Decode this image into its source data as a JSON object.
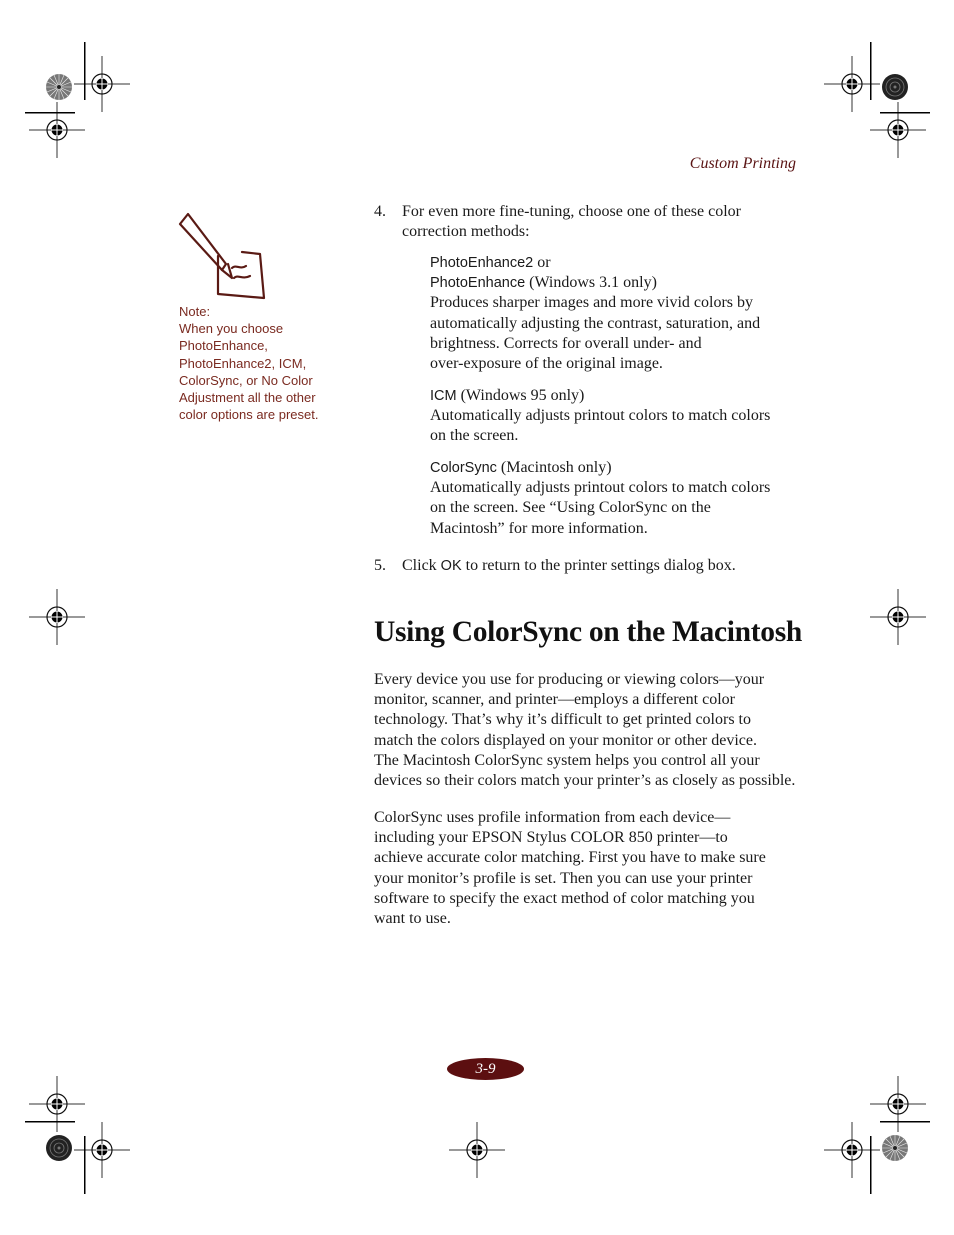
{
  "running_head": "Custom Printing",
  "note": {
    "icon": "pencil-note-icon",
    "label": "Note:",
    "lines": [
      "When you choose",
      "PhotoEnhance,",
      "PhotoEnhance2, ICM,",
      "ColorSync, or No Color",
      "Adjustment all the other",
      "color options are preset."
    ]
  },
  "steps": [
    {
      "number": "4.",
      "text_lines": [
        "For even more fine-tuning, choose one of these color",
        "correction methods:"
      ]
    },
    {
      "number": "5.",
      "text_before": "Click ",
      "ui_term": "OK",
      "text_after": " to return to the printer settings dialog box."
    }
  ],
  "methods": [
    {
      "name_line1": "PhotoEnhance2",
      "name_line1_suffix": " or",
      "name_line2": "PhotoEnhance",
      "qualifier": " (Windows 3.1 only)",
      "description_lines": [
        "Produces sharper images and more vivid colors by",
        "automatically adjusting the contrast, saturation, and",
        "brightness. Corrects for overall under- and",
        "over-exposure of the original image."
      ]
    },
    {
      "name": "ICM",
      "qualifier": " (Windows 95 only)",
      "description_lines": [
        "Automatically adjusts printout colors to match colors",
        "on the screen."
      ]
    },
    {
      "name": "ColorSync",
      "qualifier": " (Macintosh only)",
      "description_lines": [
        "Automatically adjusts printout colors to match colors",
        "on the screen. See “Using ColorSync on the",
        "Macintosh” for more information."
      ]
    }
  ],
  "section": {
    "heading": "Using ColorSync on the Macintosh",
    "paragraphs": [
      [
        "Every device you use for producing or viewing colors—your",
        "monitor, scanner, and printer—employs a different color",
        "technology. That’s why it’s difficult to get printed colors to",
        "match the colors displayed on your monitor or other device.",
        "The Macintosh ColorSync system helps you control all your",
        "devices so their colors match your printer’s as closely as possible."
      ],
      [
        "ColorSync uses profile information from each device—",
        "including your EPSON Stylus COLOR 850 printer—to",
        "achieve accurate color matching. First you have to make sure",
        "your monitor’s profile is set. Then you can use your printer",
        "software to specify the exact method of color matching you",
        "want to use."
      ]
    ]
  },
  "folio": "3-9",
  "colors": {
    "accent": "#5c0f10",
    "note_text": "#7a2a20"
  }
}
